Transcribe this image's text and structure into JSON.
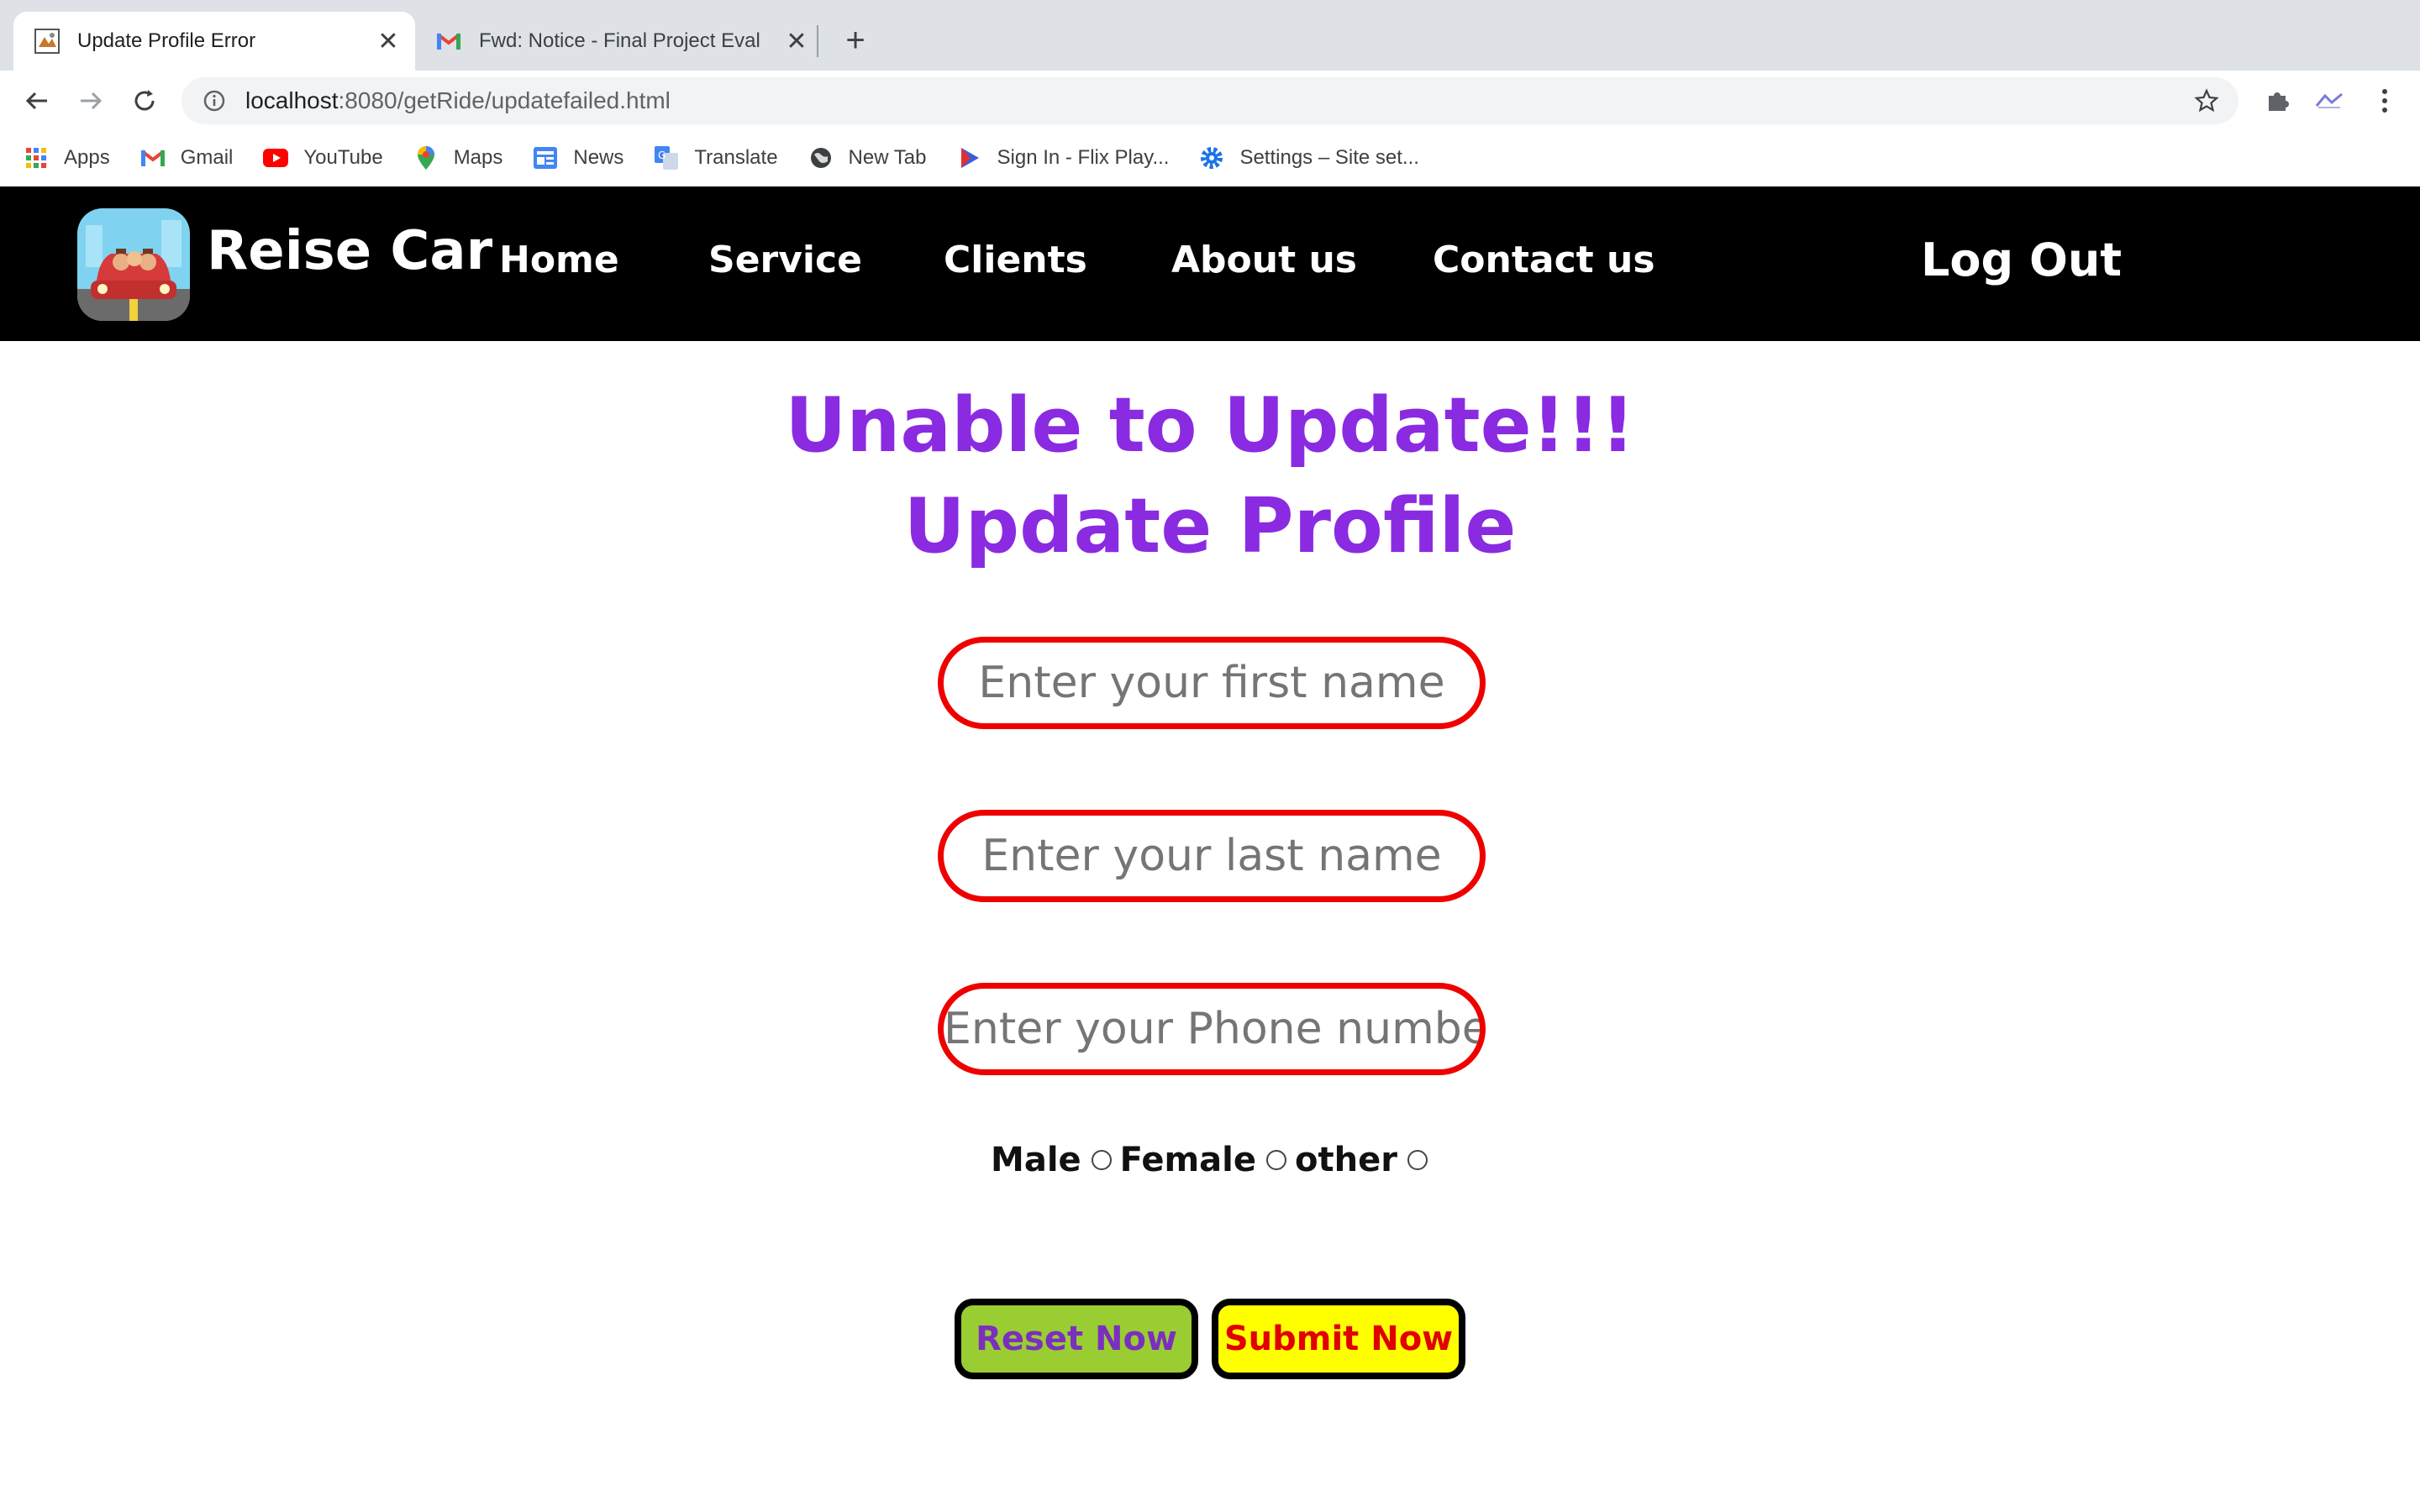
{
  "browser": {
    "tabs": [
      {
        "title": "Update Profile Error",
        "active": true
      },
      {
        "title": "Fwd: Notice - Final Project Eval",
        "active": false
      }
    ],
    "url_host": "localhost",
    "url_path": ":8080/getRide/updatefailed.html",
    "bookmarks": [
      {
        "label": "Apps",
        "icon": "apps-grid-icon"
      },
      {
        "label": "Gmail",
        "icon": "gmail-icon"
      },
      {
        "label": "YouTube",
        "icon": "youtube-icon"
      },
      {
        "label": "Maps",
        "icon": "maps-icon"
      },
      {
        "label": "News",
        "icon": "news-icon"
      },
      {
        "label": "Translate",
        "icon": "translate-icon"
      },
      {
        "label": "New Tab",
        "icon": "globe-icon"
      },
      {
        "label": "Sign In - Flix Play...",
        "icon": "play-icon"
      },
      {
        "label": "Settings – Site set...",
        "icon": "gear-icon"
      }
    ]
  },
  "site": {
    "brand": "Reise Car",
    "nav": [
      "Home",
      "Service",
      "Clients",
      "About us",
      "Contact us"
    ],
    "logout": "Log Out"
  },
  "page": {
    "error_title": "Unable to Update!!!",
    "form_title": "Update Profile",
    "first_name_placeholder": "Enter your first name",
    "last_name_placeholder": "Enter your last name",
    "phone_placeholder": "Enter your Phone number",
    "gender_options": [
      "Male",
      "Female",
      "other"
    ],
    "reset_label": "Reset Now",
    "submit_label": "Submit Now"
  },
  "colors": {
    "heading": "#8a2be2",
    "field_border": "#ee0000",
    "reset_bg": "#9acd32",
    "submit_bg": "#ffff00",
    "nav_bg": "#000000"
  }
}
